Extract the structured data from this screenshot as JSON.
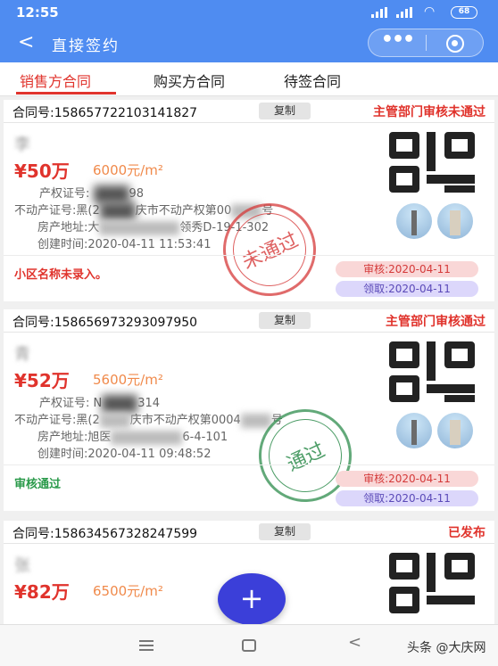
{
  "status_bar": {
    "time": "12:55",
    "battery": "68"
  },
  "header": {
    "back_icon": "chevron-left-icon",
    "title": "直接签约",
    "more_icon": "more-dots-icon",
    "close_icon": "target-close-icon"
  },
  "tabs": [
    {
      "label": "销售方合同",
      "active": true
    },
    {
      "label": "购买方合同",
      "active": false
    },
    {
      "label": "待签合同",
      "active": false
    }
  ],
  "copy_label": "复制",
  "cards": [
    {
      "contract_no": "合同号:158657722103141827",
      "status": "主管部门审核未通过",
      "status_color": "#e0332c",
      "owner_name": "李",
      "price": "¥50万",
      "unit_price": "6000元/m²",
      "cert_label": "产权证号:",
      "cert_tail": "98",
      "realty_label": "不动产证号:",
      "realty_value": "黑(2",
      "realty_mid": "庆市不动产权第00",
      "realty_tail": "号",
      "address_label": "房产地址:",
      "address_value": "大",
      "address_tail": "领秀D-19-1-302",
      "created_label": "创建时间:",
      "created_value": "2020-04-11 11:53:41",
      "stamp_text": "未通过",
      "note": "小区名称未录入。",
      "note_color": "#e0332c",
      "review": "审核:2020-04-11",
      "claim": "领取:2020-04-11"
    },
    {
      "contract_no": "合同号:158656973293097950",
      "status": "主管部门审核通过",
      "status_color": "#e0332c",
      "owner_name": "青",
      "price": "¥52万",
      "unit_price": "5600元/m²",
      "cert_label": "产权证号:",
      "cert_value": "N",
      "cert_tail": "314",
      "realty_label": "不动产证号:",
      "realty_value": "黑(2",
      "realty_mid": "庆市不动产权第0004",
      "realty_tail": "号",
      "address_label": "房产地址:",
      "address_value": "旭医",
      "address_tail": "6-4-101",
      "created_label": "创建时间:",
      "created_value": "2020-04-11 09:48:52",
      "stamp_text": "通过",
      "note": "审核通过",
      "note_color": "#2a9a4a",
      "review": "审核:2020-04-11",
      "claim": "领取:2020-04-11"
    },
    {
      "contract_no": "合同号:158634567328247599",
      "status": "已发布",
      "status_color": "#e0332c",
      "owner_name": "张",
      "price": "¥82万",
      "unit_price": "6500元/m²"
    }
  ],
  "fab_label": "+",
  "system_nav": {
    "menu_icon": "menu-icon",
    "home_icon": "home-square-icon",
    "back_icon": "back-triangle-icon"
  },
  "watermark": "头条 @大庆网"
}
